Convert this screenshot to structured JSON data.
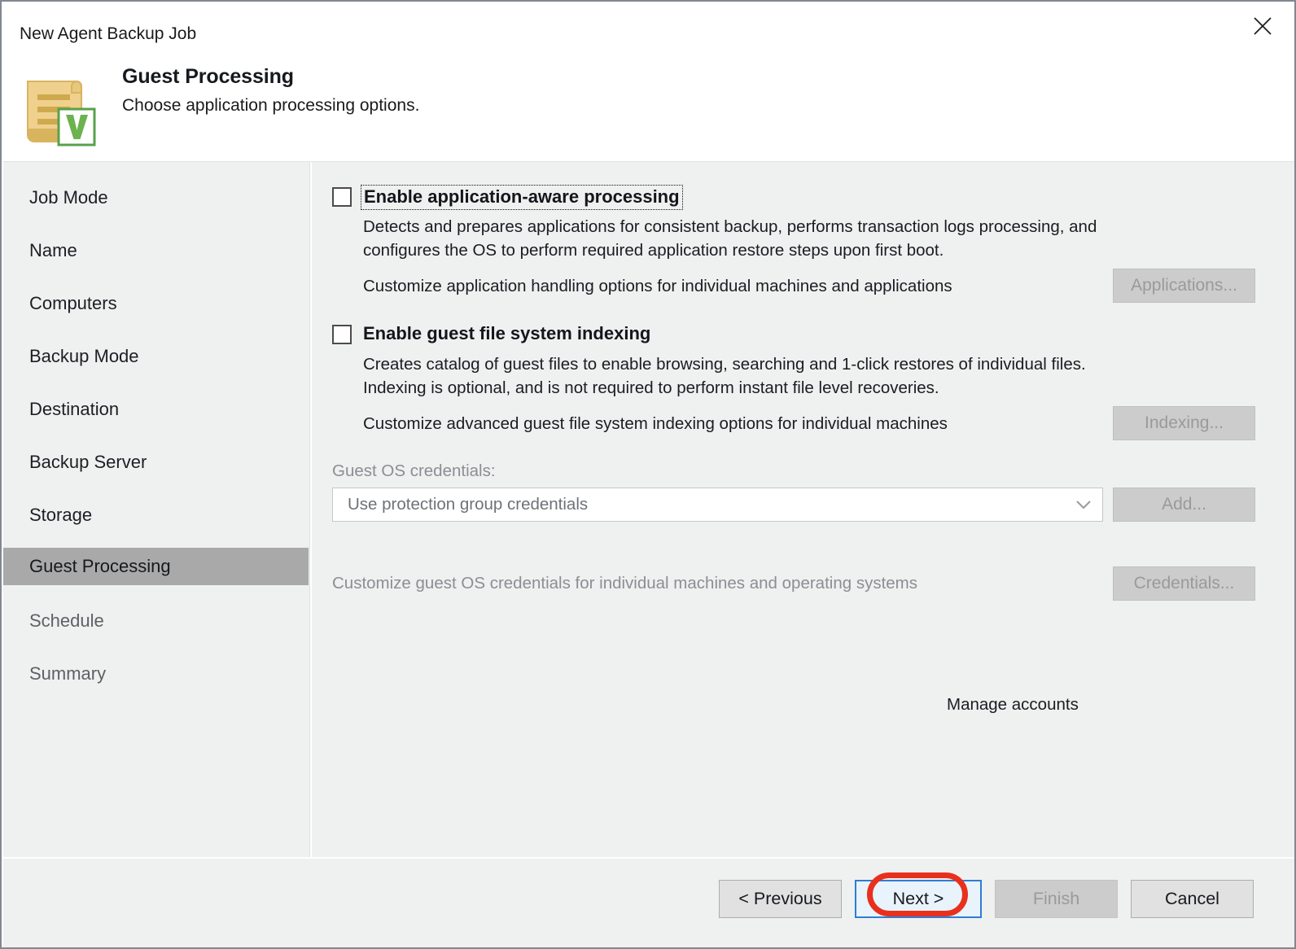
{
  "window": {
    "title": "New Agent Backup Job",
    "close_icon": "close-icon"
  },
  "header": {
    "title": "Guest Processing",
    "subtitle": "Choose application processing options.",
    "icon": "document-scroll-veeam-icon"
  },
  "sidebar": {
    "items": [
      {
        "label": "Job Mode",
        "selected": false,
        "dim": false
      },
      {
        "label": "Name",
        "selected": false,
        "dim": false
      },
      {
        "label": "Computers",
        "selected": false,
        "dim": false
      },
      {
        "label": "Backup Mode",
        "selected": false,
        "dim": false
      },
      {
        "label": "Destination",
        "selected": false,
        "dim": false
      },
      {
        "label": "Backup Server",
        "selected": false,
        "dim": false
      },
      {
        "label": "Storage",
        "selected": false,
        "dim": false
      },
      {
        "label": "Guest Processing",
        "selected": true,
        "dim": false
      },
      {
        "label": "Schedule",
        "selected": false,
        "dim": true
      },
      {
        "label": "Summary",
        "selected": false,
        "dim": true
      }
    ]
  },
  "content": {
    "app_aware": {
      "checkbox_label": "Enable application-aware processing",
      "checked": false,
      "desc_line1": "Detects and prepares applications for consistent backup, performs transaction logs processing, and",
      "desc_line2": "configures the OS to perform required application restore steps upon first boot.",
      "customize_text": "Customize application handling options for individual machines and applications",
      "button_label": "Applications...",
      "button_disabled": true
    },
    "indexing": {
      "checkbox_label": "Enable guest file system indexing",
      "checked": false,
      "desc_line1": "Creates catalog of guest files to enable browsing, searching and 1-click restores of individual files.",
      "desc_line2": "Indexing is optional, and is not required to perform instant file level recoveries.",
      "customize_text": "Customize advanced guest file system indexing options for individual machines",
      "button_label": "Indexing...",
      "button_disabled": true
    },
    "credentials": {
      "label": "Guest OS credentials:",
      "selected_value": "Use protection group credentials",
      "dropdown_icon": "chevron-down-icon",
      "add_button_label": "Add...",
      "add_button_disabled": true,
      "manage_accounts_label": "Manage accounts",
      "customize_text": "Customize guest OS credentials for individual machines and operating systems",
      "credentials_button_label": "Credentials...",
      "credentials_button_disabled": true
    }
  },
  "footer": {
    "previous_label": "< Previous",
    "next_label": "Next >",
    "finish_label": "Finish",
    "cancel_label": "Cancel",
    "finish_disabled": true,
    "next_focused": true,
    "annotation_color": "#e8301c"
  }
}
